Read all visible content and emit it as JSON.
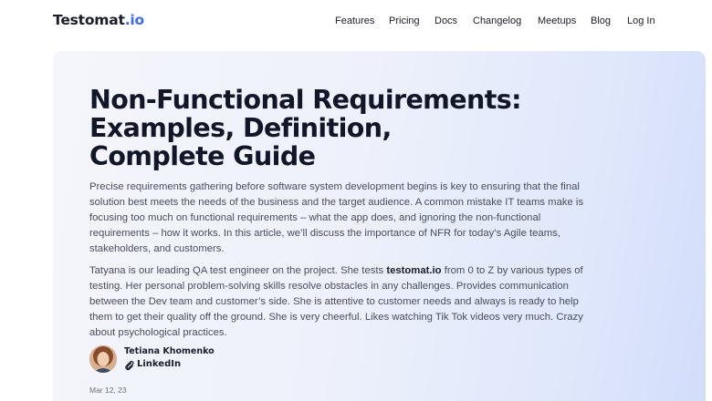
{
  "header": {
    "logo": {
      "name": "Testomat",
      "tld": ".io"
    },
    "nav": [
      {
        "label": "Features"
      },
      {
        "label": "Pricing"
      },
      {
        "label": "Docs"
      },
      {
        "label": "Changelog"
      },
      {
        "label": "Meetups"
      },
      {
        "label": "Blog"
      },
      {
        "label": "Log In"
      }
    ]
  },
  "article": {
    "title_lines": [
      "Non-Functional Requirements:",
      "Examples, Definition,",
      "Complete Guide"
    ],
    "intro_lines": [
      "Precise requirements gathering before software system development begins is key to ensuring that the final",
      "solution best meets the needs of the business and the target audience. A common mistake IT teams make is",
      "focusing too much on functional requirements – what the app does, and ignoring the non-functional",
      "requirements – how it works. In this article, we’ll discuss the importance of NFR for today’s Agile teams,",
      "stakeholders, and customers."
    ],
    "bio": {
      "line1_before": "Tatyana is our leading QA test engineer on the project. She tests ",
      "line1_bold": "testomat.io",
      "line1_after": " from 0 to Z by various types of",
      "lines": [
        "testing. Her personal problem-solving skills resolve obstacles in any challenges. Provides communication",
        "between the Dev team and customer’s side. She is attentive to customer needs and always is ready to help",
        "them to get their quality off the ground. She is very cheerful. Likes watching Tik Tok videos very much. Crazy",
        "about psychological practices."
      ]
    },
    "author": {
      "name": "Tetiana Khomenko",
      "link_label": "LinkedIn",
      "link_icon": "paperclip-icon"
    },
    "date": "Mar 12, 23"
  },
  "colors": {
    "accent": "#3d6af0",
    "text_dark": "#121629",
    "text_body": "#494c5e"
  }
}
